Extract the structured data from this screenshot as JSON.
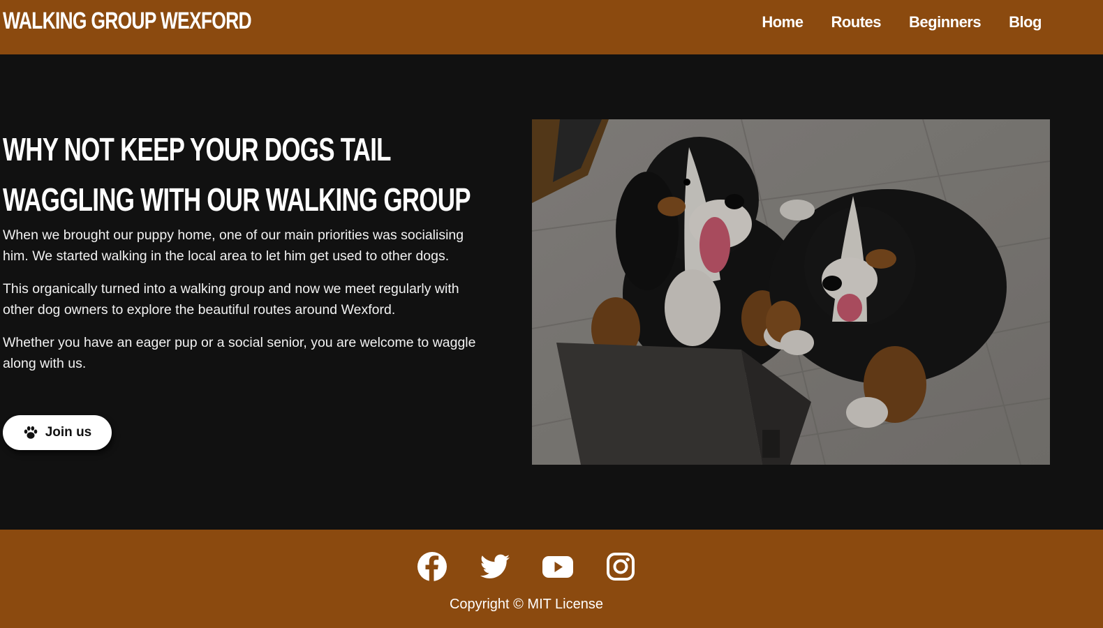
{
  "header": {
    "logo": "Walking Group Wexford",
    "nav": [
      {
        "label": "Home"
      },
      {
        "label": "Routes"
      },
      {
        "label": "Beginners"
      },
      {
        "label": "Blog"
      }
    ]
  },
  "hero": {
    "headline_line1": "Why not keep your dogs tail",
    "headline_line2": "waggling with our walking group",
    "paragraphs": [
      "When we brought our puppy home, one of our main priorities was socialising him. We started walking in the local area to let him get used to other dogs.",
      "This organically turned into a walking group and now we meet regularly with other dog owners to explore the beautiful routes around Wexford.",
      "Whether you have an eager pup or a social senior, you are welcome to waggle along with us."
    ],
    "cta_label": "Join us",
    "cta_icon": "paw-icon"
  },
  "footer": {
    "social": [
      {
        "icon": "facebook-icon"
      },
      {
        "icon": "twitter-icon"
      },
      {
        "icon": "youtube-icon"
      },
      {
        "icon": "instagram-icon"
      }
    ],
    "copyright": "Copyright © MIT License"
  },
  "colors": {
    "brand": "#8b4a0f",
    "background": "#111111",
    "text": "#ffffff"
  }
}
